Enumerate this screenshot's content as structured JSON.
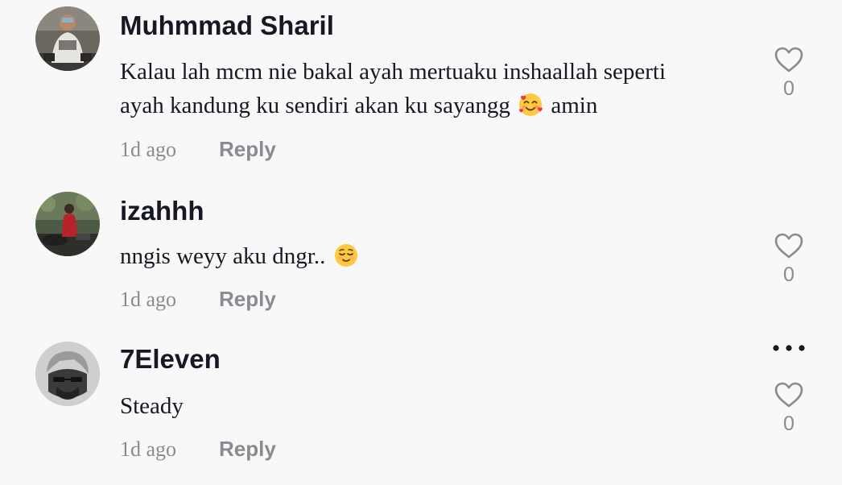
{
  "comments": [
    {
      "username": "Muhmmad Sharil",
      "text_line1": "Kalau lah mcm nie bakal ayah mertuaku inshaallah seperti",
      "text_line2_before_emoji": "ayah kandung ku sendiri akan ku sayangg ",
      "emoji": "smiling-face-with-hearts-icon",
      "text_line2_after_emoji": " amin",
      "time": "1d ago",
      "reply_label": "Reply",
      "like_count": "0"
    },
    {
      "username": "izahhh",
      "text": "nngis weyy aku dngr.. ",
      "emoji": "relieved-face-icon",
      "time": "1d ago",
      "reply_label": "Reply",
      "like_count": "0"
    },
    {
      "username": "7Eleven",
      "text": "Steady",
      "time": "1d ago",
      "reply_label": "Reply",
      "like_count": "0",
      "more_icon": "more-options-icon"
    }
  ],
  "colors": {
    "background": "#f8f8f8",
    "username": "#161823",
    "text": "#161823",
    "muted": "#8a8b91",
    "emoji_face": "#ffc83d"
  },
  "icons": {
    "like": "heart-outline-icon",
    "more": "ellipsis-horizontal-icon"
  }
}
